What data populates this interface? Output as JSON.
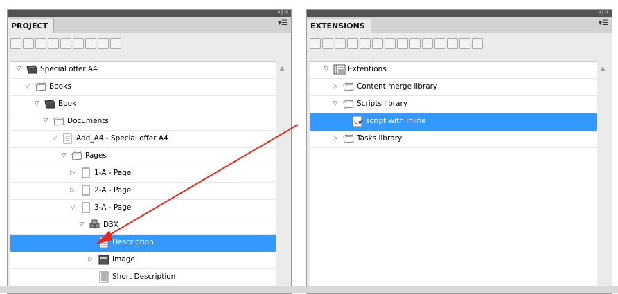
{
  "project": {
    "tab": "PROJECT",
    "window_controls": "«|×",
    "menu_icon": "▾☰",
    "toolbar_icons": [
      "new-icon",
      "save-icon",
      "properties-icon",
      "add-icon",
      "copy-icon",
      "delete-icon",
      "blank-icon",
      "preview-icon",
      "settings-icon"
    ],
    "tree": [
      {
        "label": "Special offer A4",
        "icon": "book-dark-icon",
        "expanded": true,
        "depth": 0
      },
      {
        "label": "Books",
        "icon": "folder-icon",
        "expanded": true,
        "depth": 1
      },
      {
        "label": "Book",
        "icon": "book-dark-icon",
        "expanded": true,
        "depth": 2
      },
      {
        "label": "Documents",
        "icon": "folder-icon",
        "expanded": true,
        "depth": 3
      },
      {
        "label": "Add_A4 - Special offer A4",
        "icon": "document-icon",
        "expanded": true,
        "depth": 4
      },
      {
        "label": "Pages",
        "icon": "folder-icon",
        "expanded": true,
        "depth": 5
      },
      {
        "label": "1-A - Page",
        "icon": "page-icon",
        "expanded": false,
        "depth": 6
      },
      {
        "label": "2-A - Page",
        "icon": "page-icon",
        "expanded": false,
        "depth": 6
      },
      {
        "label": "3-A - Page",
        "icon": "page-icon",
        "expanded": true,
        "depth": 6
      },
      {
        "label": "D3X",
        "icon": "component-icon",
        "expanded": true,
        "depth": 7
      },
      {
        "label": "Description",
        "icon": "text-icon",
        "expanded": null,
        "depth": 8,
        "selected": true
      },
      {
        "label": "Image",
        "icon": "image-icon",
        "expanded": false,
        "depth": 8
      },
      {
        "label": "Short Description",
        "icon": "text-icon",
        "expanded": null,
        "depth": 8
      }
    ]
  },
  "extensions": {
    "tab": "EXTENSIONS",
    "window_controls": "«|×",
    "menu_icon": "▾☰",
    "toolbar_icons": [
      "new-icon",
      "save-icon",
      "add-icon",
      "disabled-icon",
      "delete-icon",
      "move-icon",
      "copy-icon",
      "paste-icon",
      "collapse-all-icon",
      "up-icon",
      "down-icon",
      "expand-all-icon",
      "refresh-icon",
      "settings-icon"
    ],
    "tree": [
      {
        "label": "Extentions",
        "icon": "list-window-icon",
        "expanded": true,
        "depth": 0
      },
      {
        "label": "Content merge library",
        "icon": "folder-icon",
        "expanded": false,
        "depth": 1
      },
      {
        "label": "Scripts library",
        "icon": "folder-icon",
        "expanded": true,
        "depth": 1
      },
      {
        "label": "script with inline",
        "icon": "csharp-script-icon",
        "expanded": null,
        "depth": 2,
        "selected": true
      },
      {
        "label": "Tasks library",
        "icon": "folder-icon",
        "expanded": false,
        "depth": 1
      }
    ]
  },
  "colors": {
    "selection": "#3399ff",
    "arrow": "#e8261c",
    "titlebar": "#535353"
  }
}
